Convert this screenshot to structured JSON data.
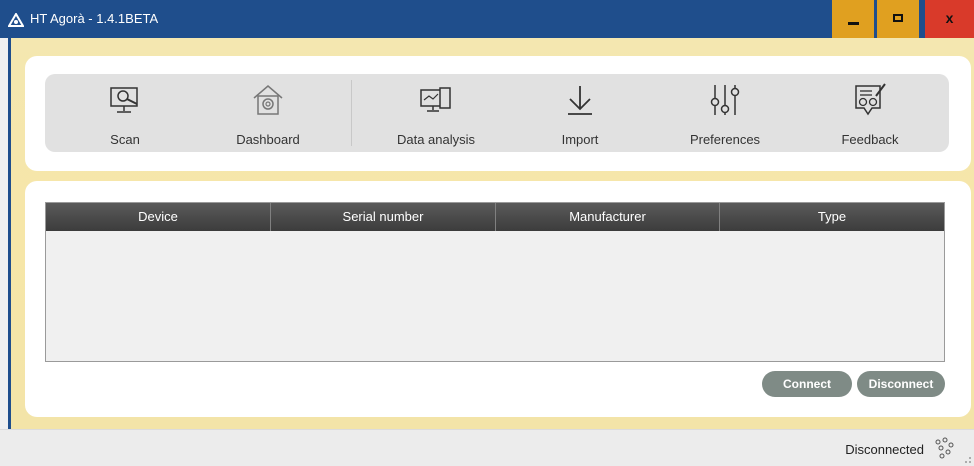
{
  "window": {
    "title": "HT Agorà - 1.4.1BETA",
    "minimize_glyph": "",
    "maximize_glyph": "",
    "close_glyph": "x"
  },
  "toolbar": {
    "items": [
      {
        "label": "Scan",
        "icon": "scan-icon"
      },
      {
        "label": "Dashboard",
        "icon": "dashboard-icon"
      },
      {
        "label": "Data analysis",
        "icon": "data-analysis-icon"
      },
      {
        "label": "Import",
        "icon": "import-icon"
      },
      {
        "label": "Preferences",
        "icon": "preferences-icon"
      },
      {
        "label": "Feedback",
        "icon": "feedback-icon"
      }
    ]
  },
  "devices_table": {
    "columns": [
      "Device",
      "Serial number",
      "Manufacturer",
      "Type"
    ],
    "rows": []
  },
  "actions": {
    "connect_label": "Connect",
    "disconnect_label": "Disconnect"
  },
  "status": {
    "text": "Disconnected",
    "icon": "connection-status-icon"
  },
  "colors": {
    "titlebar": "#1f4e8c",
    "accent_gold": "#e0a020",
    "close_red": "#d93a2a",
    "pill_button": "#7f8b86",
    "frame_gold": "#f4e7b0"
  }
}
